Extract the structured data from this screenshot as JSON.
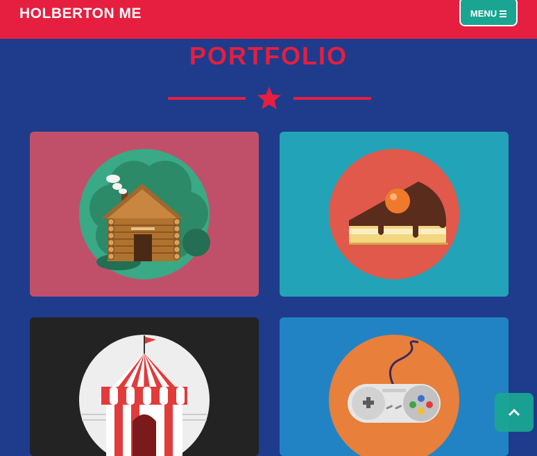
{
  "header": {
    "brand": "HOLBERTON ME",
    "menu_label": "MENU",
    "menu_icon": "bars-icon"
  },
  "portfolio": {
    "title": "PORTFOLIO",
    "divider_icon": "star-icon",
    "items": [
      {
        "name": "cabin",
        "icon": "cabin-illustration",
        "card_color": "#c0506a",
        "circle_color": "#3aa985"
      },
      {
        "name": "cake",
        "icon": "cake-illustration",
        "card_color": "#22a3b8",
        "circle_color": "#e0594a"
      },
      {
        "name": "circus",
        "icon": "circus-tent-illustration",
        "card_color": "#232323",
        "circle_color": "#eeeeee"
      },
      {
        "name": "game",
        "icon": "game-controller-illustration",
        "card_color": "#2283c4",
        "circle_color": "#e87f3b"
      }
    ]
  },
  "back_to_top_icon": "chevron-up-icon",
  "colors": {
    "background": "#1e3c8b",
    "accent": "#e61e3f",
    "teal": "#1aa592"
  }
}
